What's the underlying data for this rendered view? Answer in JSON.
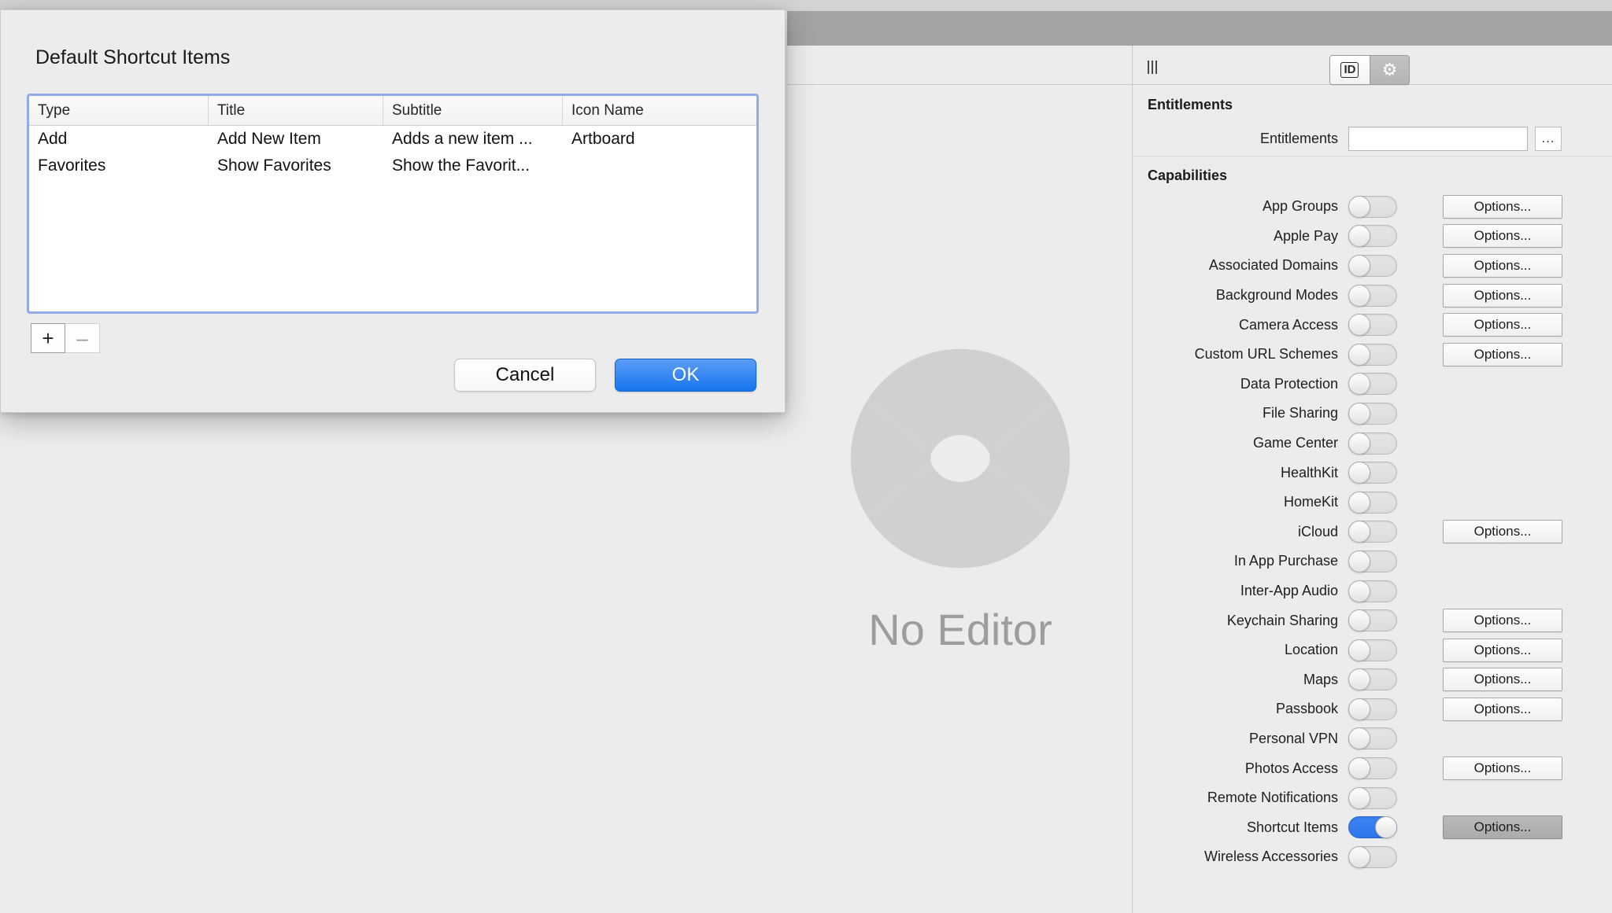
{
  "window": {
    "toolbar": {
      "hamburger_icon": "hamburger-icon",
      "segmented": {
        "id_label": "ID",
        "id_icon": "identity-icon",
        "gear_icon": "gear-icon"
      }
    }
  },
  "editor": {
    "placeholder_text": "No Editor",
    "placeholder_icon": "xcode-no-editor-icon"
  },
  "inspector": {
    "entitlements": {
      "header": "Entitlements",
      "field_label": "Entitlements",
      "field_value": "",
      "field_placeholder": "",
      "browse_label": "...",
      "browse_icon": "ellipsis-icon"
    },
    "capabilities": {
      "header": "Capabilities",
      "options_label": "Options...",
      "rows": [
        {
          "label": "App Groups",
          "enabled": false,
          "has_options": true
        },
        {
          "label": "Apple Pay",
          "enabled": false,
          "has_options": true
        },
        {
          "label": "Associated Domains",
          "enabled": false,
          "has_options": true
        },
        {
          "label": "Background Modes",
          "enabled": false,
          "has_options": true
        },
        {
          "label": "Camera Access",
          "enabled": false,
          "has_options": true
        },
        {
          "label": "Custom URL Schemes",
          "enabled": false,
          "has_options": true
        },
        {
          "label": "Data Protection",
          "enabled": false,
          "has_options": false
        },
        {
          "label": "File Sharing",
          "enabled": false,
          "has_options": false
        },
        {
          "label": "Game Center",
          "enabled": false,
          "has_options": false
        },
        {
          "label": "HealthKit",
          "enabled": false,
          "has_options": false
        },
        {
          "label": "HomeKit",
          "enabled": false,
          "has_options": false
        },
        {
          "label": "iCloud",
          "enabled": false,
          "has_options": true
        },
        {
          "label": "In App Purchase",
          "enabled": false,
          "has_options": false
        },
        {
          "label": "Inter-App Audio",
          "enabled": false,
          "has_options": false
        },
        {
          "label": "Keychain Sharing",
          "enabled": false,
          "has_options": true
        },
        {
          "label": "Location",
          "enabled": false,
          "has_options": true
        },
        {
          "label": "Maps",
          "enabled": false,
          "has_options": true
        },
        {
          "label": "Passbook",
          "enabled": false,
          "has_options": true
        },
        {
          "label": "Personal VPN",
          "enabled": false,
          "has_options": false
        },
        {
          "label": "Photos Access",
          "enabled": false,
          "has_options": true
        },
        {
          "label": "Remote Notifications",
          "enabled": false,
          "has_options": false
        },
        {
          "label": "Shortcut Items",
          "enabled": true,
          "has_options": true,
          "options_pressed": true
        },
        {
          "label": "Wireless Accessories",
          "enabled": false,
          "has_options": false
        }
      ]
    }
  },
  "dialog": {
    "title": "Default Shortcut Items",
    "table": {
      "columns": [
        "Type",
        "Title",
        "Subtitle",
        "Icon Name"
      ],
      "rows": [
        {
          "type": "Add",
          "title": "Add New Item",
          "subtitle": "Adds a new item ...",
          "icon_name": "Artboard"
        },
        {
          "type": "Favorites",
          "title": "Show Favorites",
          "subtitle": "Show the Favorit...",
          "icon_name": ""
        }
      ]
    },
    "add_label": "+",
    "remove_label": "–",
    "cancel_label": "Cancel",
    "ok_label": "OK",
    "accent_color": "#1675f0",
    "focus_ring_color": "#8fabe8"
  }
}
